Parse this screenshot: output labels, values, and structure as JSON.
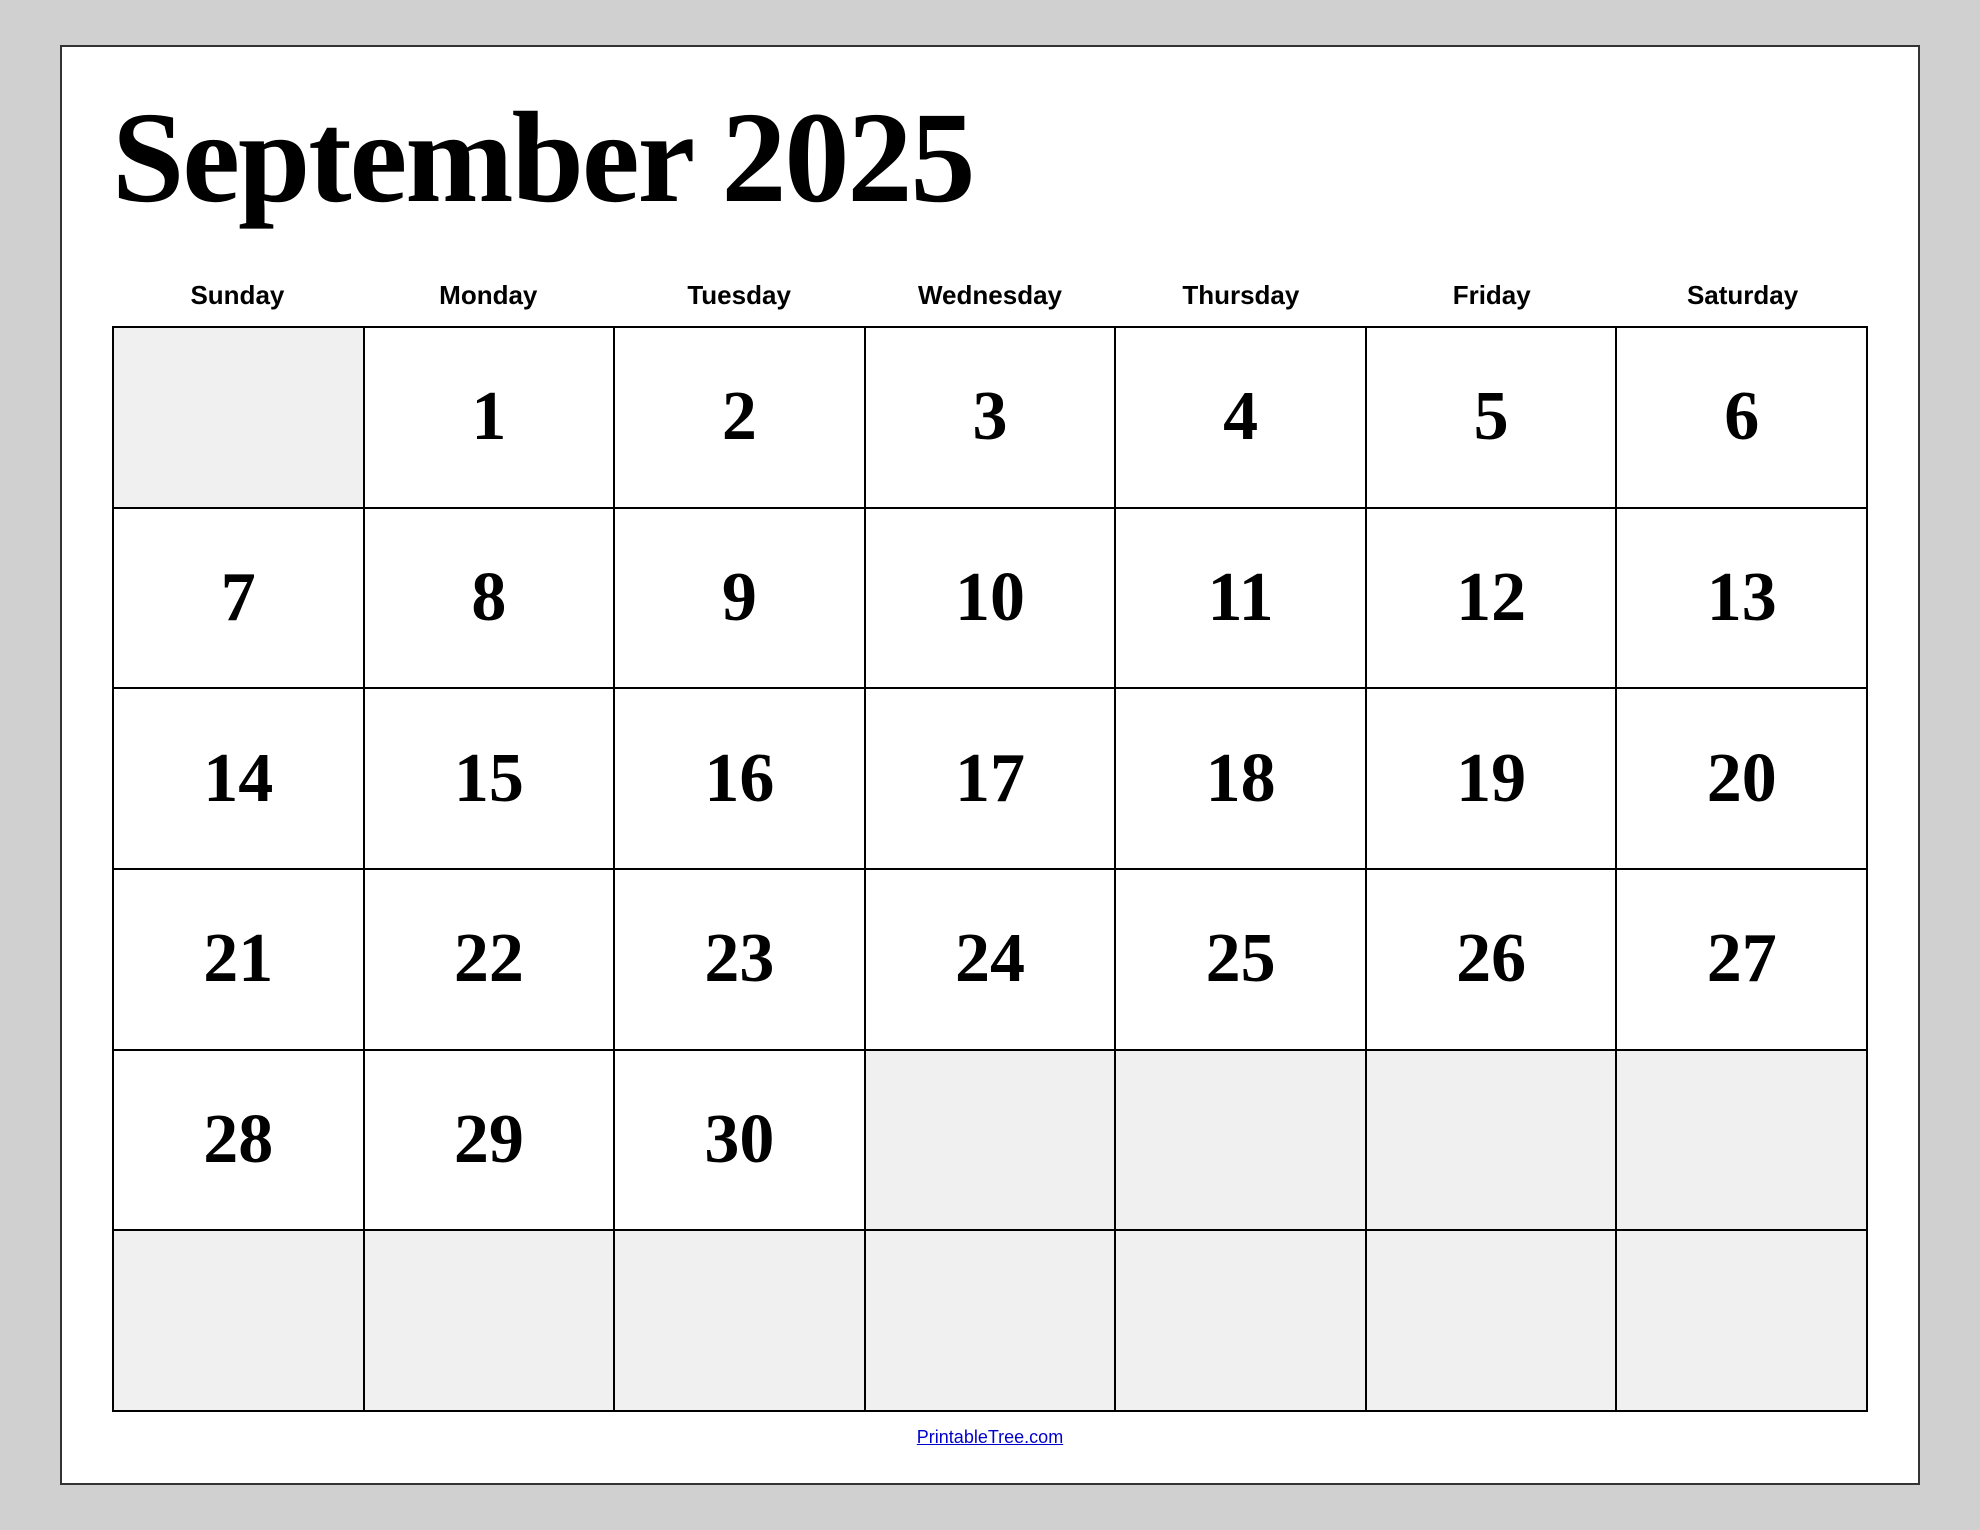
{
  "title": "September 2025",
  "headers": [
    "Sunday",
    "Monday",
    "Tuesday",
    "Wednesday",
    "Thursday",
    "Friday",
    "Saturday"
  ],
  "weeks": [
    [
      null,
      "1",
      "2",
      "3",
      "4",
      "5",
      "6"
    ],
    [
      "7",
      "8",
      "9",
      "10",
      "11",
      "12",
      "13"
    ],
    [
      "14",
      "15",
      "16",
      "17",
      "18",
      "19",
      "20"
    ],
    [
      "21",
      "22",
      "23",
      "24",
      "25",
      "26",
      "27"
    ],
    [
      "28",
      "29",
      "30",
      null,
      null,
      null,
      null
    ],
    [
      null,
      null,
      null,
      null,
      null,
      null,
      null
    ]
  ],
  "footer": {
    "link_text": "PrintableTree.com",
    "link_url": "#"
  }
}
